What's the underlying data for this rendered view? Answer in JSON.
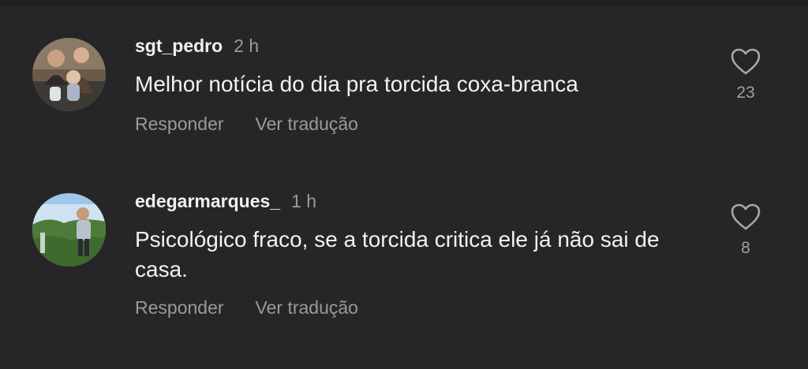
{
  "comments": [
    {
      "username": "sgt_pedro",
      "time": "2 h",
      "text": "Melhor notícia do dia pra torcida coxa-branca",
      "likes": "23",
      "reply_label": "Responder",
      "translate_label": "Ver tradução"
    },
    {
      "username": "edegarmarques_",
      "time": "1 h",
      "text": "Psicológico fraco, se a torcida critica ele já não sai de casa.",
      "likes": "8",
      "reply_label": "Responder",
      "translate_label": "Ver tradução"
    }
  ],
  "icons": {
    "like": "heart-outline-icon"
  },
  "colors": {
    "background": "#262628",
    "primary_text": "#f2f2f2",
    "secondary_text": "#9a9a9a"
  }
}
